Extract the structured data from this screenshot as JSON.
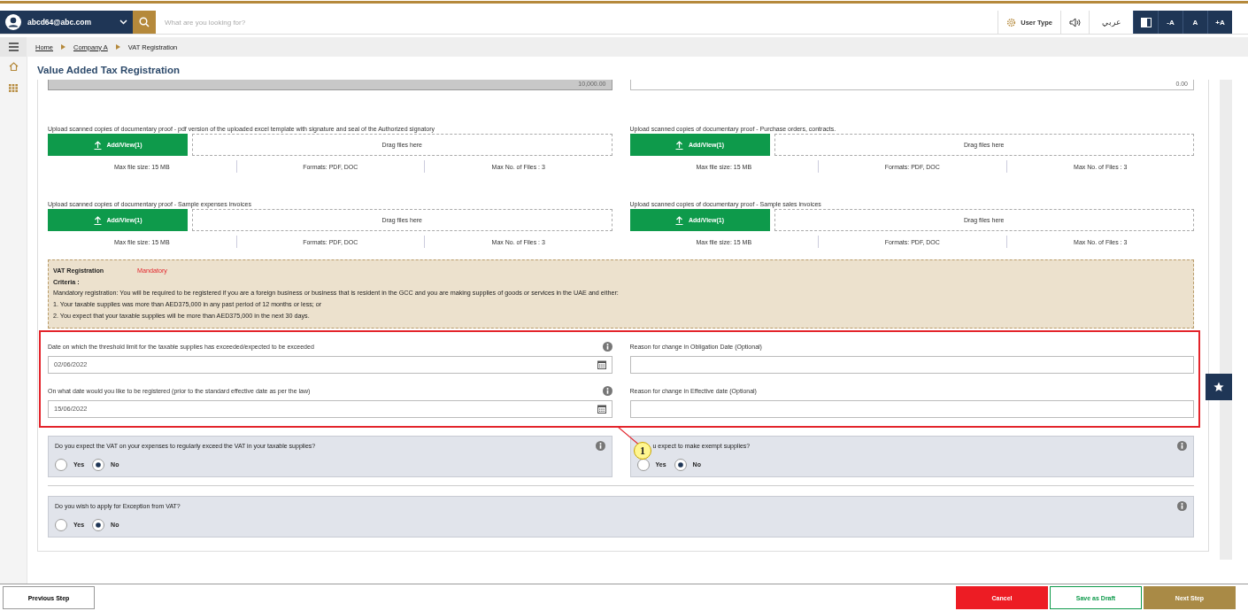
{
  "header": {
    "user_email": "abcd64@abc.com",
    "search": {
      "placeholder": "What are you looking for?"
    },
    "user_type": "User Type",
    "language": "عربي",
    "font_buttons": [
      "-A",
      "A",
      "+A"
    ]
  },
  "breadcrumb": [
    "Home",
    "Company A",
    "VAT Registration"
  ],
  "page_title": "Value Added Tax Registration",
  "partial_fields": [
    "10,000.00",
    "0.00"
  ],
  "uploads": [
    {
      "label": "Upload scanned copies of documentary proof - pdf version of the uploaded excel template with signature and seal of the Authorized signatory",
      "button": "Add/View(1)",
      "drop": "Drag files here",
      "max_size": "Max file size: 15 MB",
      "formats": "Formats: PDF, DOC",
      "max_files": "Max No. of Files : 3"
    },
    {
      "label": "Upload scanned copies of documentary proof - Purchase orders, contracts.",
      "button": "Add/View(1)",
      "drop": "Drag files here",
      "max_size": "Max file size: 15 MB",
      "formats": "Formats: PDF, DOC",
      "max_files": "Max No. of Files : 3"
    },
    {
      "label": "Upload scanned copies of documentary proof - Sample expenses invoices",
      "button": "Add/View(1)",
      "drop": "Drag files here",
      "max_size": "Max file size: 15 MB",
      "formats": "Formats: PDF, DOC",
      "max_files": "Max No. of Files : 3"
    },
    {
      "label": "Upload scanned copies of documentary proof - Sample sales invoices",
      "button": "Add/View(1)",
      "drop": "Drag files here",
      "max_size": "Max file size: 15 MB",
      "formats": "Formats: PDF, DOC",
      "max_files": "Max No. of Files : 3"
    }
  ],
  "criteria": {
    "title": "VAT Registration",
    "badge": "Mandatory",
    "heading": "Criteria :",
    "lines": [
      "Mandatory registration: You will be required to be registered if you are a foreign business or business that is resident in the GCC and you are making supplies of goods or services in the UAE and either:",
      "1. Your taxable supplies was more than AED375,000 in any past period of 12 months or less; or",
      "2. You expect that your taxable supplies will be more than AED375,000 in the next 30 days."
    ]
  },
  "highlight": {
    "callout": "1",
    "fields": [
      {
        "kind": "date",
        "label": "Date on which the threshold limit for the taxable supplies has exceeded/expected to be exceeded",
        "value": "02/06/2022"
      },
      {
        "kind": "text",
        "label": "Reason for change in Obligation Date (Optional)"
      },
      {
        "kind": "date",
        "label": "On what date would you like to be registered (prior to the standard effective date as per the law)",
        "value": "15/06/2022"
      },
      {
        "kind": "text",
        "label": "Reason for change in Effective date (Optional)"
      }
    ]
  },
  "questions": [
    {
      "text": "Do you expect the VAT on your expenses to regularly exceed the VAT in your taxable supplies?",
      "options": [
        {
          "label": "Yes",
          "selected": false
        },
        {
          "label": "No",
          "selected": true
        }
      ]
    },
    {
      "text": "u expect to make exempt supplies?",
      "options": [
        {
          "label": "Yes",
          "selected": false
        },
        {
          "label": "No",
          "selected": true
        }
      ]
    },
    {
      "text": "Do you wish to apply for Exception from VAT?",
      "options": [
        {
          "label": "Yes",
          "selected": false
        },
        {
          "label": "No",
          "selected": true
        }
      ]
    }
  ],
  "footer": {
    "previous": "Previous Step",
    "cancel": "Cancel",
    "draft": "Save as Draft",
    "next": "Next Step"
  }
}
